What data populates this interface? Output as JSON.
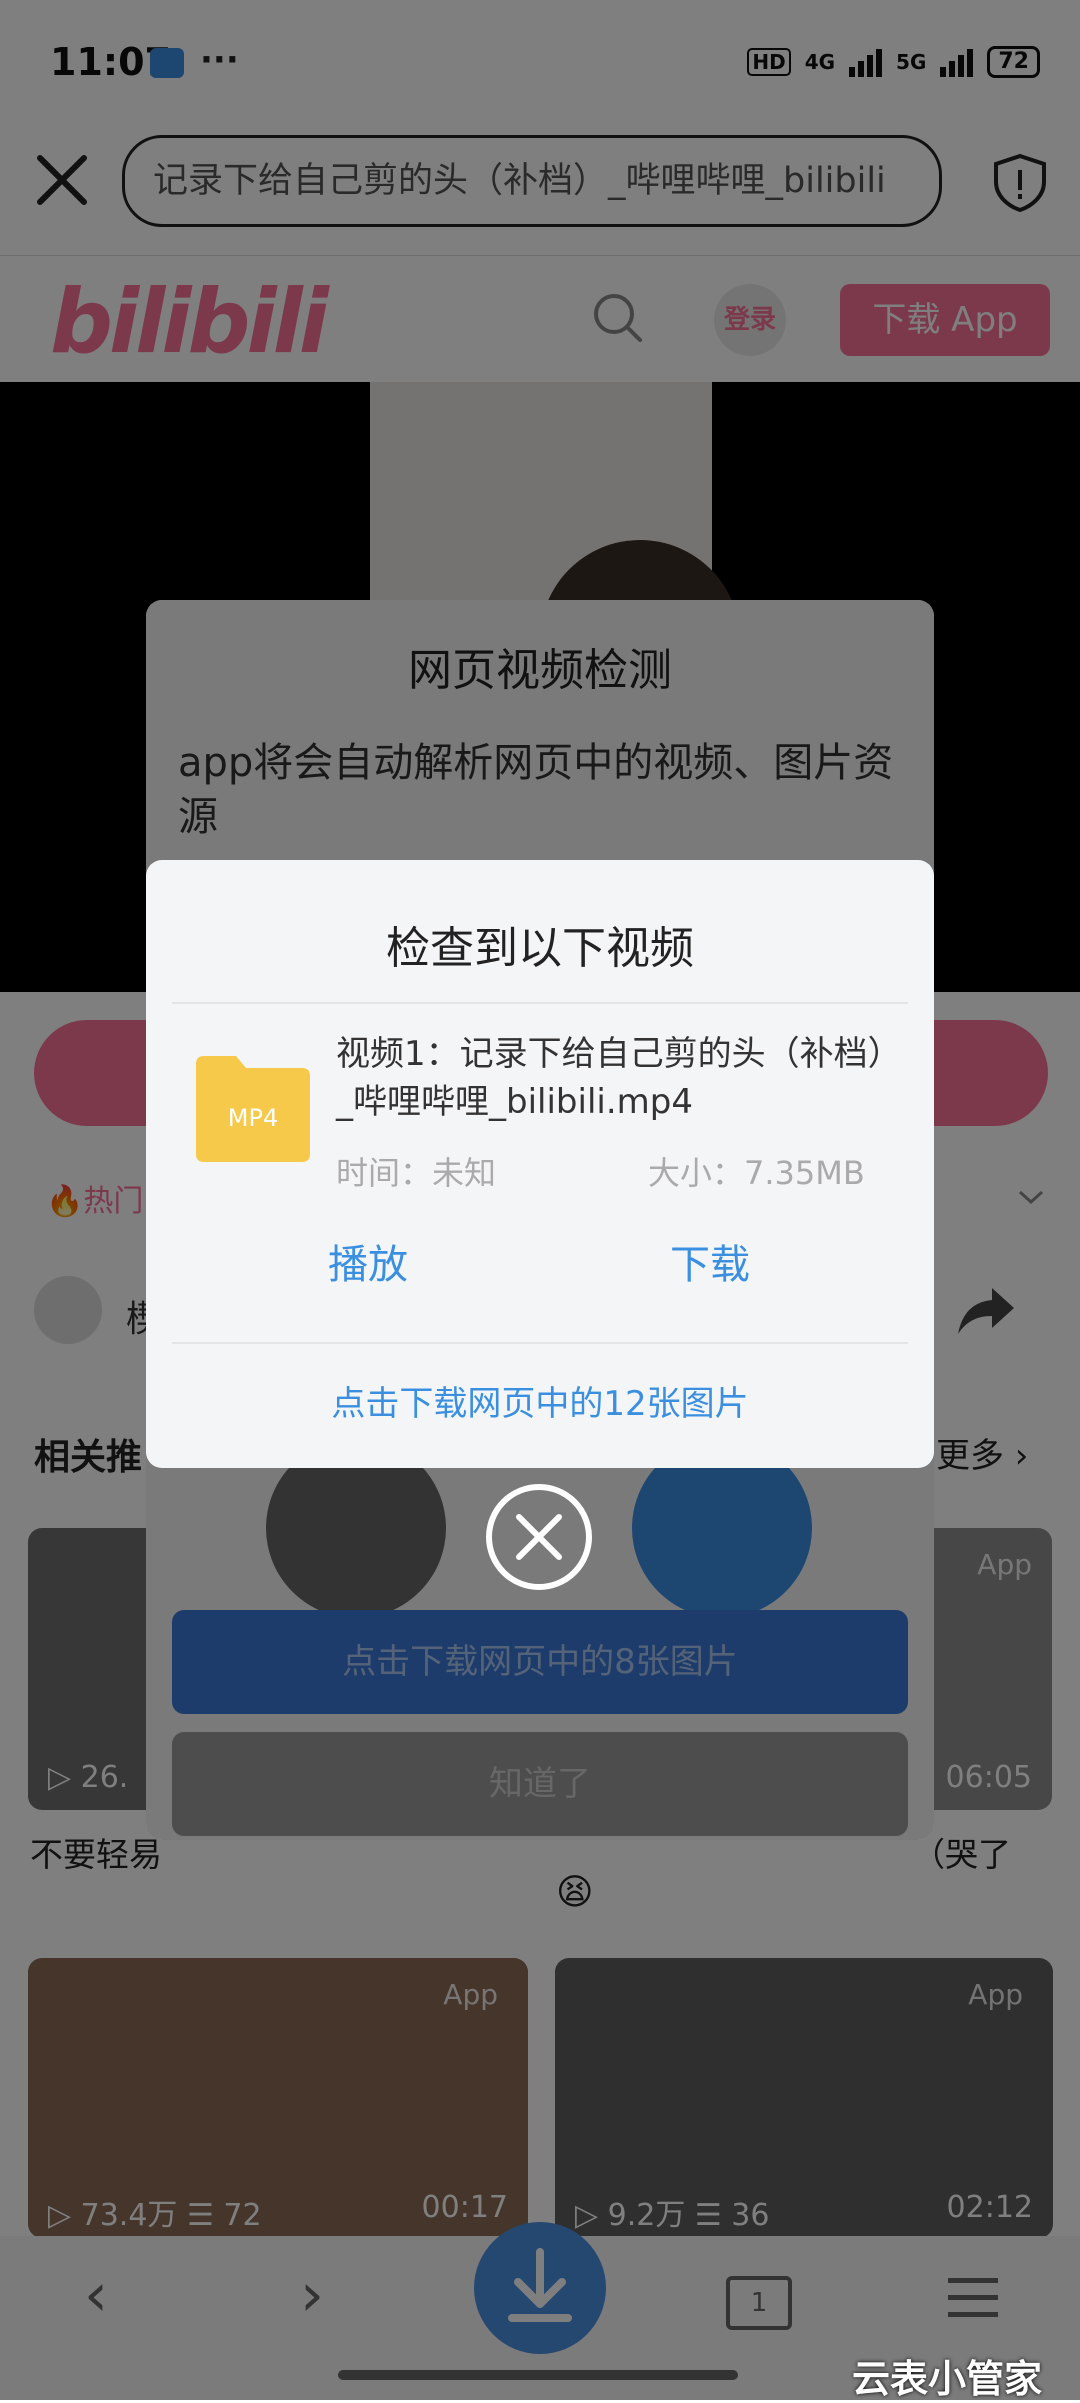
{
  "status_bar": {
    "time": "11:07",
    "network1": "4G",
    "network2": "5G",
    "battery": "72",
    "hd": "HD"
  },
  "url_bar": {
    "url_text": "记录下给自己剪的头（补档）_哔哩哔哩_bilibili"
  },
  "bili_header": {
    "logo": "bilibili",
    "login_label": "登录",
    "download_app_label": "下载 App"
  },
  "page": {
    "hot_label": "热门",
    "author_initial": "楔",
    "related_label": "相关推",
    "more_label": "更多",
    "cards": [
      {
        "app_tag": "App",
        "views": "26.",
        "duration": ""
      },
      {
        "app_tag": "App",
        "views": "",
        "duration": "06:05"
      },
      {
        "app_tag": "App",
        "views": "73.4万",
        "comments": "72",
        "duration": "00:17"
      },
      {
        "app_tag": "App",
        "views": "9.2万",
        "comments": "36",
        "duration": "02:12"
      }
    ],
    "card_title_left": "不要轻易",
    "card_title_right": "（哭了",
    "emoji": "😫"
  },
  "dialog_behind": {
    "title": "网页视频检测",
    "description": "app将会自动解析网页中的视频、图片资源",
    "download_images_label": "点击下载网页中的8张图片",
    "ok_label": "知道了"
  },
  "dialog_front": {
    "title": "检查到以下视频",
    "file_badge": "MP4",
    "file_name": "视频1：记录下给自己剪的头（补档）_哔哩哔哩_bilibili.mp4",
    "time_label": "时间：未知",
    "size_label": "大小：7.35MB",
    "play_label": "播放",
    "download_label": "下载",
    "download_images_label": "点击下载网页中的12张图片"
  },
  "bottom_nav": {
    "tabs_count": "1"
  },
  "watermark": "云表小管家",
  "colors": {
    "bili_pink": "#fb7299",
    "link_blue": "#3a8fe0",
    "dialog_bg": "#f4f5f7"
  }
}
